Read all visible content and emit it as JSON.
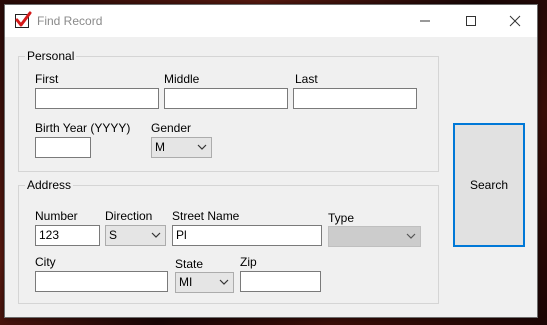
{
  "window": {
    "title": "Find Record",
    "icons": {
      "app": "checkbox-check-icon",
      "minimize": "minimize-icon",
      "maximize": "maximize-icon",
      "close": "close-icon"
    }
  },
  "personal": {
    "legend": "Personal",
    "first_label": "First",
    "first_value": "",
    "middle_label": "Middle",
    "middle_value": "",
    "last_label": "Last",
    "last_value": "",
    "birth_year_label": "Birth Year (YYYY)",
    "birth_year_value": "",
    "gender_label": "Gender",
    "gender_value": "M"
  },
  "address": {
    "legend": "Address",
    "number_label": "Number",
    "number_value": "123",
    "direction_label": "Direction",
    "direction_value": "S",
    "street_name_label": "Street Name",
    "street_name_value": "Pl",
    "type_label": "Type",
    "type_value": "",
    "city_label": "City",
    "city_value": "",
    "state_label": "State",
    "state_value": "MI",
    "zip_label": "Zip",
    "zip_value": ""
  },
  "search_button": {
    "label": "Search"
  }
}
